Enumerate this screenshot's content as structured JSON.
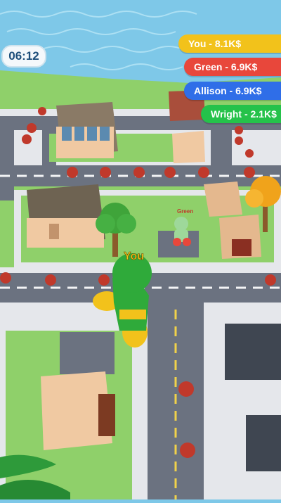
{
  "hud": {
    "timer": "06:12"
  },
  "leaderboard": [
    {
      "label": "You - 8.1K$",
      "color": "#f2c21b",
      "text_color": "#ffffff"
    },
    {
      "label": "Green - 6.9K$",
      "color": "#e8473b",
      "text_color": "#ffffff"
    },
    {
      "label": "Allison - 6.9K$",
      "color": "#2f6ee8",
      "text_color": "#ffffff"
    },
    {
      "label": "Wright - 2.1K$",
      "color": "#25c24a",
      "text_color": "#ffffff"
    }
  ],
  "player": {
    "name_tag": "You",
    "color": "#2faa3a"
  },
  "rival": {
    "name_tag": "Green"
  },
  "colors": {
    "water": "#7ec8e8",
    "grass": "#8fd06a",
    "road": "#6b7280",
    "sidewalk": "#e5e7eb",
    "building": "#f0c9a2"
  }
}
